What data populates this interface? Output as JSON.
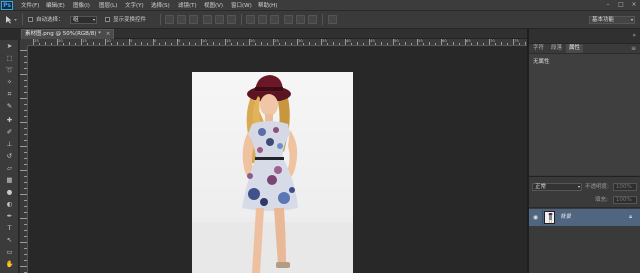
{
  "app": {
    "logo": "Ps"
  },
  "menu": [
    "文件(F)",
    "编辑(E)",
    "图像(I)",
    "图层(L)",
    "文字(Y)",
    "选择(S)",
    "滤镜(T)",
    "视图(V)",
    "窗口(W)",
    "帮助(H)"
  ],
  "options_bar": {
    "auto_select_label": "自动选择：",
    "auto_select_value": "组",
    "show_transform_label": "显示变换控件",
    "workspace": "基本功能"
  },
  "document": {
    "tab_title": "素材图.png @ 50%(RGB/8) *",
    "ruler_numbers": [
      "25",
      "20",
      "15",
      "10",
      "5",
      "0",
      "5",
      "10",
      "15",
      "20",
      "25",
      "30",
      "35",
      "40",
      "45",
      "50",
      "55",
      "60",
      "65",
      "70",
      "75"
    ]
  },
  "panel": {
    "tabs": [
      "字符",
      "段落",
      "属性"
    ],
    "active_tab": "属性",
    "properties_title": "无属性"
  },
  "layers": {
    "blend_mode": "正常",
    "opacity_label": "不透明度:",
    "opacity_value": "100%",
    "fill_label": "填充:",
    "fill_value": "100%",
    "items": [
      {
        "name": "背景"
      }
    ]
  },
  "colors": {
    "accent": "#31a8ff",
    "layer_selected": "#4f6580"
  }
}
